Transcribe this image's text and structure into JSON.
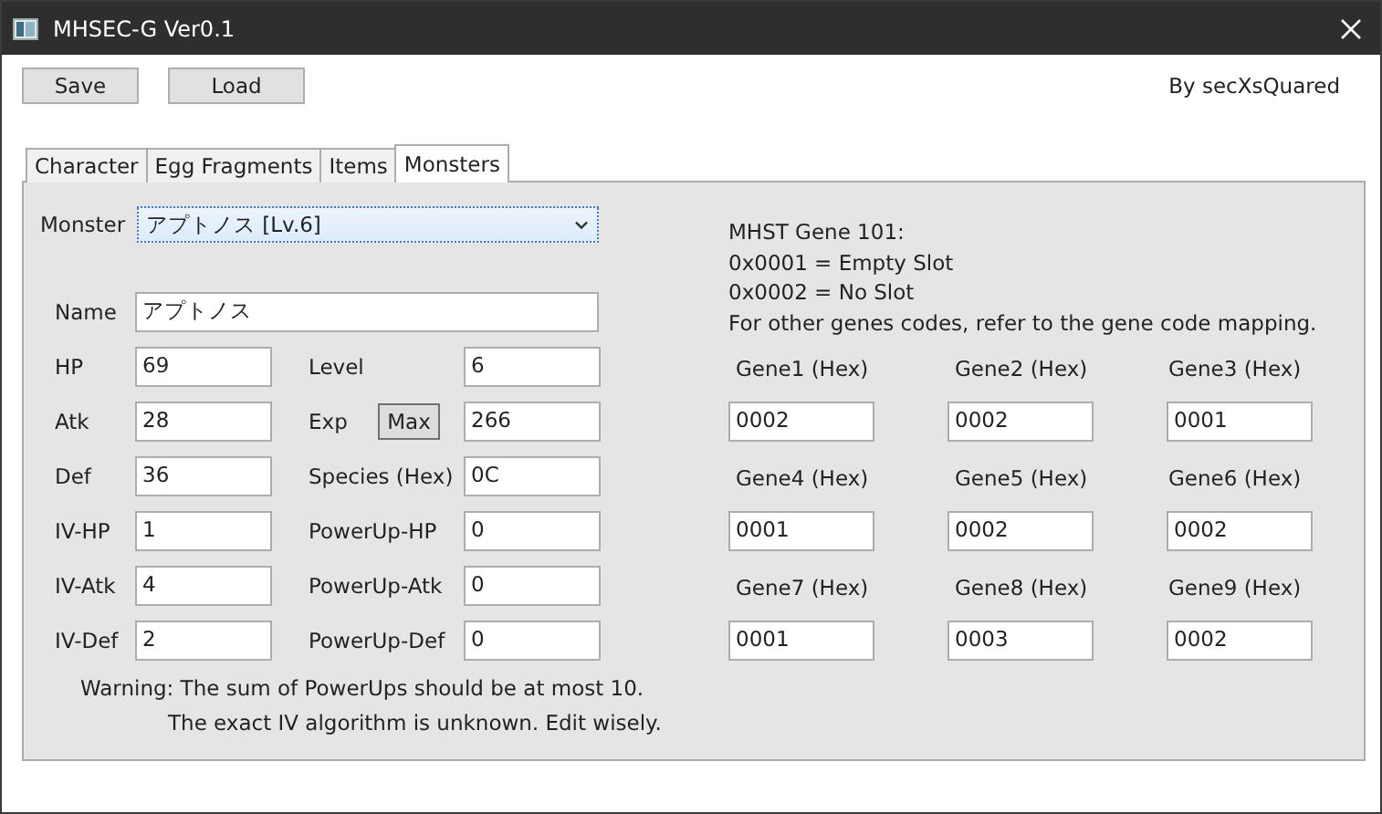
{
  "window": {
    "title": "MHSEC-G Ver0.1"
  },
  "toolbar": {
    "buttons": [
      "Save",
      "Load"
    ],
    "credit": "By secXsQuared"
  },
  "tabs": [
    {
      "label": "Character",
      "selected": false
    },
    {
      "label": "Egg Fragments",
      "selected": false
    },
    {
      "label": "Items",
      "selected": false
    },
    {
      "label": "Monsters",
      "selected": true
    }
  ],
  "monster_select": {
    "label": "Monster",
    "value": "アプトノス [Lv.6]"
  },
  "name_field": {
    "label": "Name",
    "value": "アプトノス"
  },
  "stat_rows": [
    {
      "left": {
        "label": "HP",
        "value": "69"
      },
      "right": {
        "label": "Level",
        "value": "6"
      }
    },
    {
      "left": {
        "label": "Atk",
        "value": "28"
      },
      "right": {
        "label": "Exp",
        "button": "Max",
        "value": "266"
      }
    },
    {
      "left": {
        "label": "Def",
        "value": "36"
      },
      "right": {
        "label": "Species (Hex)",
        "value": "0C"
      }
    },
    {
      "left": {
        "label": "IV-HP",
        "value": "1"
      },
      "right": {
        "label": "PowerUp-HP",
        "value": "0"
      }
    },
    {
      "left": {
        "label": "IV-Atk",
        "value": "4"
      },
      "right": {
        "label": "PowerUp-Atk",
        "value": "0"
      }
    },
    {
      "left": {
        "label": "IV-Def",
        "value": "2"
      },
      "right": {
        "label": "PowerUp-Def",
        "value": "0"
      }
    }
  ],
  "warnings": [
    "Warning: The sum of PowerUps should be at most 10.",
    "The exact IV algorithm is unknown. Edit wisely."
  ],
  "gene_info": [
    "MHST Gene 101:",
    "0x0001 = Empty Slot",
    "0x0002 = No Slot",
    "For other genes codes, refer to the gene code mapping."
  ],
  "genes": [
    {
      "label": "Gene1 (Hex)",
      "value": "0002"
    },
    {
      "label": "Gene2 (Hex)",
      "value": "0002"
    },
    {
      "label": "Gene3 (Hex)",
      "value": "0001"
    },
    {
      "label": "Gene4 (Hex)",
      "value": "0001"
    },
    {
      "label": "Gene5 (Hex)",
      "value": "0002"
    },
    {
      "label": "Gene6 (Hex)",
      "value": "0002"
    },
    {
      "label": "Gene7 (Hex)",
      "value": "0001"
    },
    {
      "label": "Gene8 (Hex)",
      "value": "0003"
    },
    {
      "label": "Gene9 (Hex)",
      "value": "0002"
    }
  ]
}
